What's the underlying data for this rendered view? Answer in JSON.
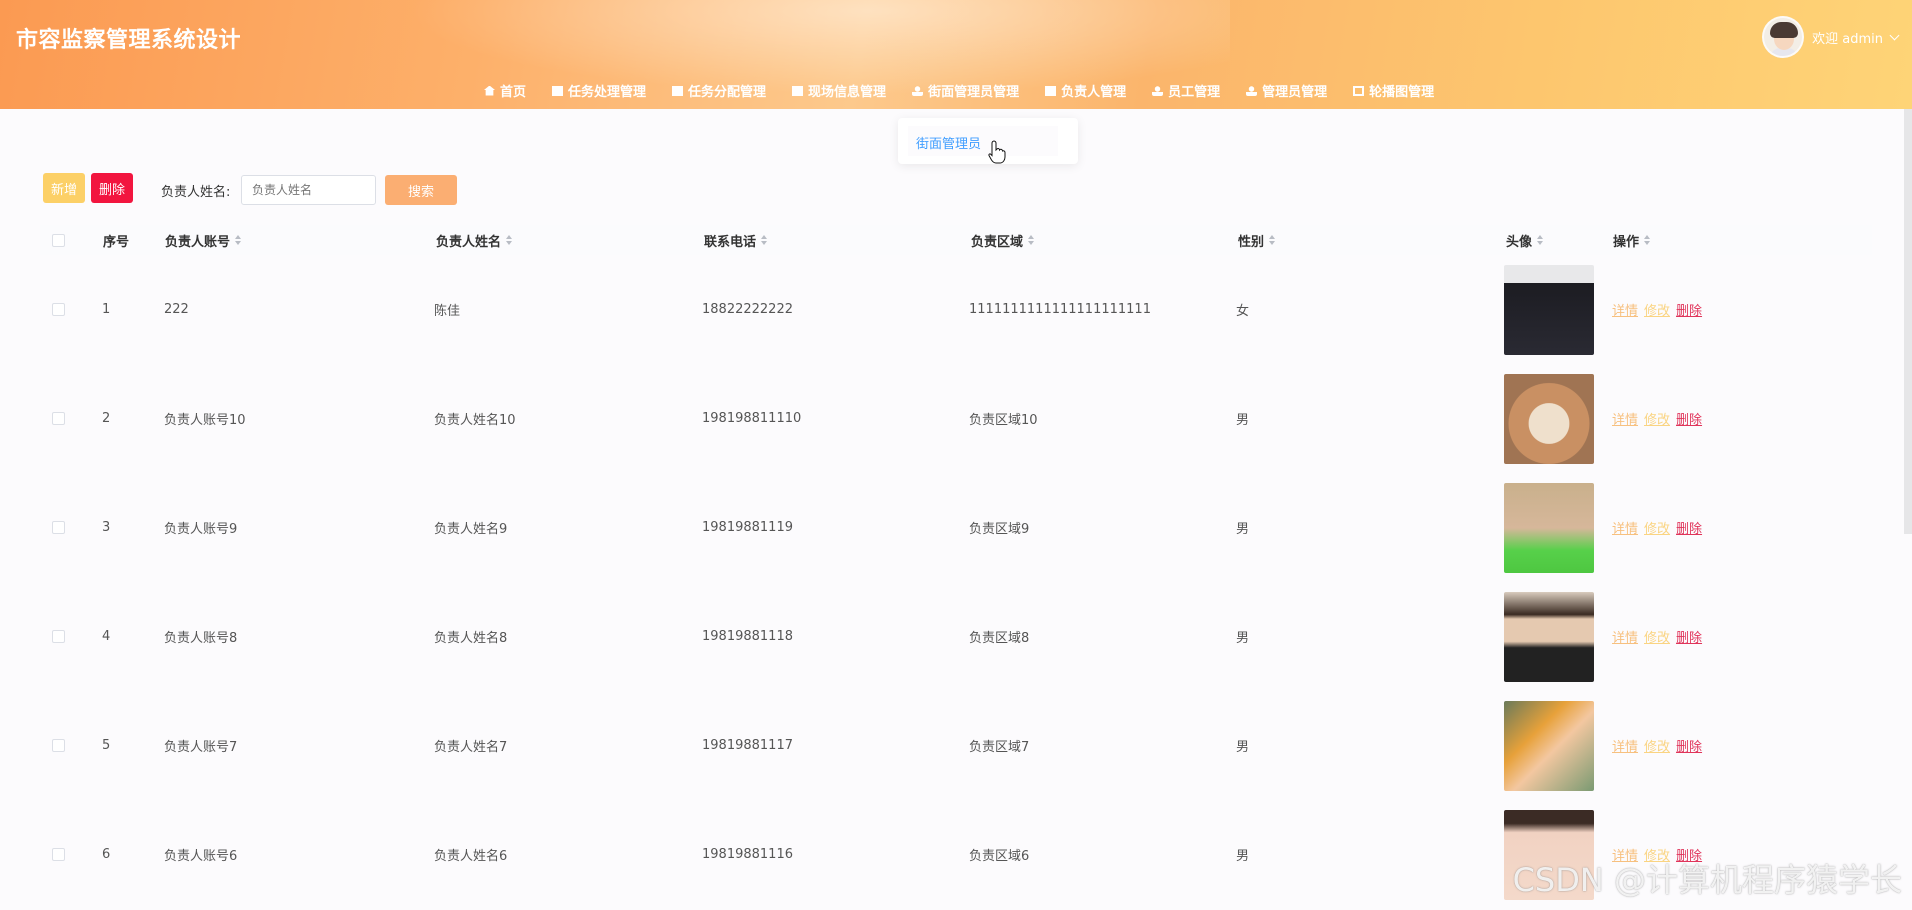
{
  "app": {
    "title": "市容监察管理系统设计"
  },
  "user": {
    "welcome": "欢迎 admin"
  },
  "nav": [
    {
      "label": "首页",
      "icon": "home-icon"
    },
    {
      "label": "任务处理管理",
      "icon": "grid-icon"
    },
    {
      "label": "任务分配管理",
      "icon": "grid-icon"
    },
    {
      "label": "现场信息管理",
      "icon": "grid-icon"
    },
    {
      "label": "街面管理员管理",
      "icon": "user-icon"
    },
    {
      "label": "负责人管理",
      "icon": "grid-icon"
    },
    {
      "label": "员工管理",
      "icon": "user-icon"
    },
    {
      "label": "管理员管理",
      "icon": "user-icon"
    },
    {
      "label": "轮播图管理",
      "icon": "image-icon"
    }
  ],
  "dropdown": {
    "item": "街面管理员"
  },
  "toolbar": {
    "add_label": "新增",
    "delete_label": "删除",
    "search_label": "负责人姓名:",
    "search_placeholder": "负责人姓名",
    "search_button": "搜索"
  },
  "table": {
    "headers": [
      "序号",
      "负责人账号",
      "负责人姓名",
      "联系电话",
      "负责区域",
      "性别",
      "头像",
      "操作"
    ],
    "rows": [
      {
        "no": "1",
        "account": "222",
        "name": "陈佳",
        "phone": "18822222222",
        "area": "1111111111111111111111",
        "gender": "女"
      },
      {
        "no": "2",
        "account": "负责人账号10",
        "name": "负责人姓名10",
        "phone": "198198811110",
        "area": "负责区域10",
        "gender": "男"
      },
      {
        "no": "3",
        "account": "负责人账号9",
        "name": "负责人姓名9",
        "phone": "19819881119",
        "area": "负责区域9",
        "gender": "男"
      },
      {
        "no": "4",
        "account": "负责人账号8",
        "name": "负责人姓名8",
        "phone": "19819881118",
        "area": "负责区域8",
        "gender": "男"
      },
      {
        "no": "5",
        "account": "负责人账号7",
        "name": "负责人姓名7",
        "phone": "19819881117",
        "area": "负责区域7",
        "gender": "男"
      },
      {
        "no": "6",
        "account": "负责人账号6",
        "name": "负责人姓名6",
        "phone": "19819881116",
        "area": "负责区域6",
        "gender": "男"
      }
    ],
    "ops": {
      "detail": "详情",
      "edit": "修改",
      "delete": "删除"
    }
  },
  "watermark": "CSDN @计算机程序猿学长",
  "colors": {
    "header_start": "#fb9a52",
    "header_end": "#fed477",
    "add": "#fcd067",
    "delete": "#f2153f",
    "search": "#fbae72",
    "link": "#409eff"
  }
}
